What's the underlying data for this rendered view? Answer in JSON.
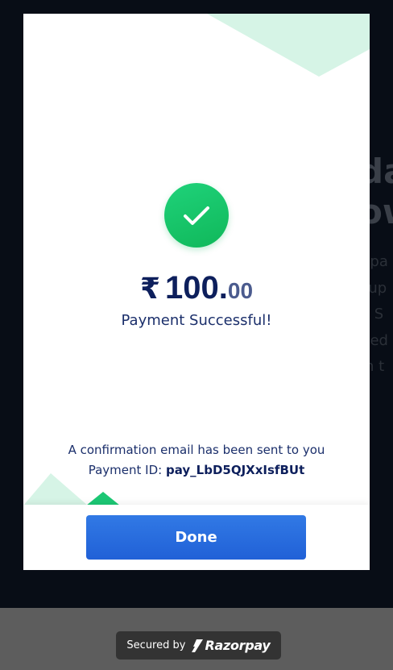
{
  "background": {
    "heading_lines": [
      "da",
      "ow"
    ],
    "paragraph_lines": [
      "Spa",
      "sup",
      "e S",
      ". ed",
      "in t"
    ]
  },
  "modal": {
    "success_icon": "checkmark-icon",
    "amount": {
      "currency": "₹",
      "whole": "100",
      "decimal": ".",
      "paise": "00"
    },
    "status": "Payment Successful!",
    "confirmation_text": "A confirmation email has been sent to you",
    "payment_id_label": "Payment ID:",
    "payment_id": "pay_LbD5QJXxIsfBUt",
    "done_label": "Done"
  },
  "footer": {
    "secured_by": "Secured by",
    "brand": "Razorpay",
    "brand_icon": "razorpay-logo-icon"
  },
  "colors": {
    "success": "#14c16a",
    "primary_button": "#2b6de0",
    "amount_text": "#0d1f5c",
    "decor_mint": "#d4f3e4",
    "badge_bg": "#333333"
  }
}
